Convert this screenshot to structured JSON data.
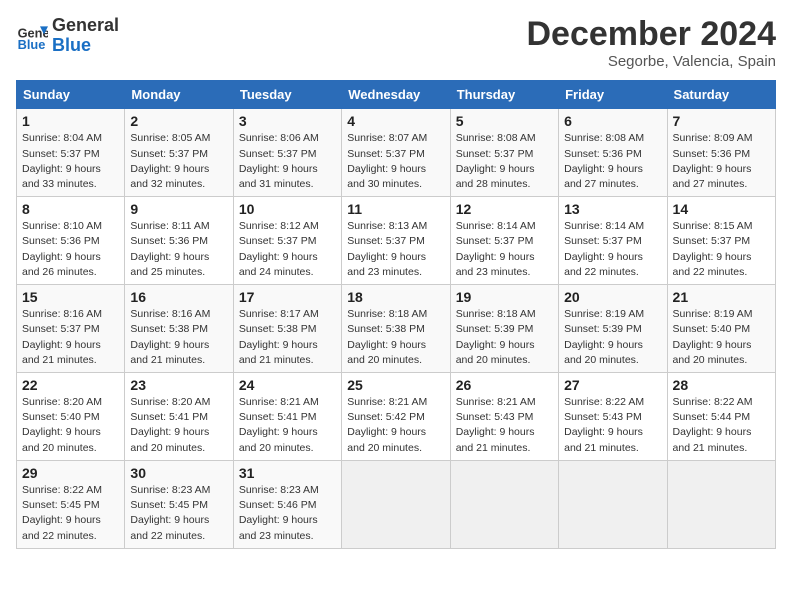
{
  "header": {
    "logo_line1": "General",
    "logo_line2": "Blue",
    "month": "December 2024",
    "location": "Segorbe, Valencia, Spain"
  },
  "weekdays": [
    "Sunday",
    "Monday",
    "Tuesday",
    "Wednesday",
    "Thursday",
    "Friday",
    "Saturday"
  ],
  "weeks": [
    [
      {
        "day": "1",
        "sunrise": "Sunrise: 8:04 AM",
        "sunset": "Sunset: 5:37 PM",
        "daylight": "Daylight: 9 hours and 33 minutes."
      },
      {
        "day": "2",
        "sunrise": "Sunrise: 8:05 AM",
        "sunset": "Sunset: 5:37 PM",
        "daylight": "Daylight: 9 hours and 32 minutes."
      },
      {
        "day": "3",
        "sunrise": "Sunrise: 8:06 AM",
        "sunset": "Sunset: 5:37 PM",
        "daylight": "Daylight: 9 hours and 31 minutes."
      },
      {
        "day": "4",
        "sunrise": "Sunrise: 8:07 AM",
        "sunset": "Sunset: 5:37 PM",
        "daylight": "Daylight: 9 hours and 30 minutes."
      },
      {
        "day": "5",
        "sunrise": "Sunrise: 8:08 AM",
        "sunset": "Sunset: 5:37 PM",
        "daylight": "Daylight: 9 hours and 28 minutes."
      },
      {
        "day": "6",
        "sunrise": "Sunrise: 8:08 AM",
        "sunset": "Sunset: 5:36 PM",
        "daylight": "Daylight: 9 hours and 27 minutes."
      },
      {
        "day": "7",
        "sunrise": "Sunrise: 8:09 AM",
        "sunset": "Sunset: 5:36 PM",
        "daylight": "Daylight: 9 hours and 27 minutes."
      }
    ],
    [
      {
        "day": "8",
        "sunrise": "Sunrise: 8:10 AM",
        "sunset": "Sunset: 5:36 PM",
        "daylight": "Daylight: 9 hours and 26 minutes."
      },
      {
        "day": "9",
        "sunrise": "Sunrise: 8:11 AM",
        "sunset": "Sunset: 5:36 PM",
        "daylight": "Daylight: 9 hours and 25 minutes."
      },
      {
        "day": "10",
        "sunrise": "Sunrise: 8:12 AM",
        "sunset": "Sunset: 5:37 PM",
        "daylight": "Daylight: 9 hours and 24 minutes."
      },
      {
        "day": "11",
        "sunrise": "Sunrise: 8:13 AM",
        "sunset": "Sunset: 5:37 PM",
        "daylight": "Daylight: 9 hours and 23 minutes."
      },
      {
        "day": "12",
        "sunrise": "Sunrise: 8:14 AM",
        "sunset": "Sunset: 5:37 PM",
        "daylight": "Daylight: 9 hours and 23 minutes."
      },
      {
        "day": "13",
        "sunrise": "Sunrise: 8:14 AM",
        "sunset": "Sunset: 5:37 PM",
        "daylight": "Daylight: 9 hours and 22 minutes."
      },
      {
        "day": "14",
        "sunrise": "Sunrise: 8:15 AM",
        "sunset": "Sunset: 5:37 PM",
        "daylight": "Daylight: 9 hours and 22 minutes."
      }
    ],
    [
      {
        "day": "15",
        "sunrise": "Sunrise: 8:16 AM",
        "sunset": "Sunset: 5:37 PM",
        "daylight": "Daylight: 9 hours and 21 minutes."
      },
      {
        "day": "16",
        "sunrise": "Sunrise: 8:16 AM",
        "sunset": "Sunset: 5:38 PM",
        "daylight": "Daylight: 9 hours and 21 minutes."
      },
      {
        "day": "17",
        "sunrise": "Sunrise: 8:17 AM",
        "sunset": "Sunset: 5:38 PM",
        "daylight": "Daylight: 9 hours and 21 minutes."
      },
      {
        "day": "18",
        "sunrise": "Sunrise: 8:18 AM",
        "sunset": "Sunset: 5:38 PM",
        "daylight": "Daylight: 9 hours and 20 minutes."
      },
      {
        "day": "19",
        "sunrise": "Sunrise: 8:18 AM",
        "sunset": "Sunset: 5:39 PM",
        "daylight": "Daylight: 9 hours and 20 minutes."
      },
      {
        "day": "20",
        "sunrise": "Sunrise: 8:19 AM",
        "sunset": "Sunset: 5:39 PM",
        "daylight": "Daylight: 9 hours and 20 minutes."
      },
      {
        "day": "21",
        "sunrise": "Sunrise: 8:19 AM",
        "sunset": "Sunset: 5:40 PM",
        "daylight": "Daylight: 9 hours and 20 minutes."
      }
    ],
    [
      {
        "day": "22",
        "sunrise": "Sunrise: 8:20 AM",
        "sunset": "Sunset: 5:40 PM",
        "daylight": "Daylight: 9 hours and 20 minutes."
      },
      {
        "day": "23",
        "sunrise": "Sunrise: 8:20 AM",
        "sunset": "Sunset: 5:41 PM",
        "daylight": "Daylight: 9 hours and 20 minutes."
      },
      {
        "day": "24",
        "sunrise": "Sunrise: 8:21 AM",
        "sunset": "Sunset: 5:41 PM",
        "daylight": "Daylight: 9 hours and 20 minutes."
      },
      {
        "day": "25",
        "sunrise": "Sunrise: 8:21 AM",
        "sunset": "Sunset: 5:42 PM",
        "daylight": "Daylight: 9 hours and 20 minutes."
      },
      {
        "day": "26",
        "sunrise": "Sunrise: 8:21 AM",
        "sunset": "Sunset: 5:43 PM",
        "daylight": "Daylight: 9 hours and 21 minutes."
      },
      {
        "day": "27",
        "sunrise": "Sunrise: 8:22 AM",
        "sunset": "Sunset: 5:43 PM",
        "daylight": "Daylight: 9 hours and 21 minutes."
      },
      {
        "day": "28",
        "sunrise": "Sunrise: 8:22 AM",
        "sunset": "Sunset: 5:44 PM",
        "daylight": "Daylight: 9 hours and 21 minutes."
      }
    ],
    [
      {
        "day": "29",
        "sunrise": "Sunrise: 8:22 AM",
        "sunset": "Sunset: 5:45 PM",
        "daylight": "Daylight: 9 hours and 22 minutes."
      },
      {
        "day": "30",
        "sunrise": "Sunrise: 8:23 AM",
        "sunset": "Sunset: 5:45 PM",
        "daylight": "Daylight: 9 hours and 22 minutes."
      },
      {
        "day": "31",
        "sunrise": "Sunrise: 8:23 AM",
        "sunset": "Sunset: 5:46 PM",
        "daylight": "Daylight: 9 hours and 23 minutes."
      },
      null,
      null,
      null,
      null
    ]
  ]
}
